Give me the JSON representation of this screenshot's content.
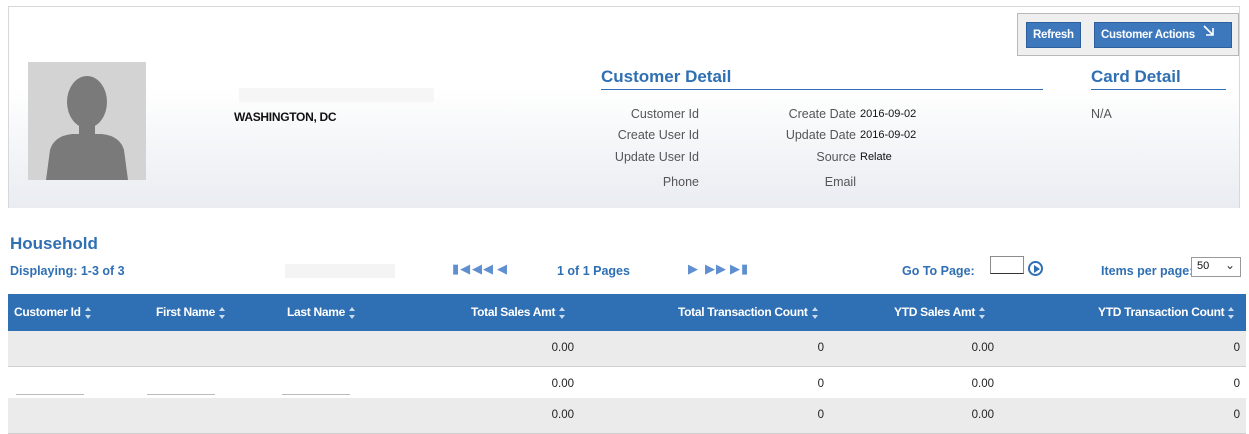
{
  "header": {
    "location": "WASHINGTON, DC",
    "buttons": {
      "refresh": "Refresh",
      "customer_actions": "Customer Actions"
    }
  },
  "customer_detail": {
    "title": "Customer Detail",
    "labels": {
      "customer_id": "Customer Id",
      "create_user_id": "Create User Id",
      "update_user_id": "Update User Id",
      "phone": "Phone",
      "create_date": "Create Date",
      "update_date": "Update Date",
      "source": "Source",
      "email": "Email"
    },
    "values": {
      "create_date": "2016-09-02",
      "update_date": "2016-09-02",
      "source": "Relate"
    }
  },
  "card_detail": {
    "title": "Card Detail",
    "value": "N/A"
  },
  "household": {
    "title": "Household",
    "displaying": "Displaying: 1-3 of 3",
    "page_info": "1 of 1 Pages",
    "goto_label": "Go To Page:",
    "items_per_page_label": "Items per page:",
    "items_per_page_value": "50",
    "columns": [
      "Customer Id",
      "First Name",
      "Last Name",
      "Total Sales Amt",
      "Total Transaction Count",
      "YTD Sales Amt",
      "YTD Transaction Count"
    ],
    "rows": [
      {
        "total_sales": "0.00",
        "total_txn": "0",
        "ytd_sales": "0.00",
        "ytd_txn": "0"
      },
      {
        "total_sales": "0.00",
        "total_txn": "0",
        "ytd_sales": "0.00",
        "ytd_txn": "0"
      },
      {
        "total_sales": "0.00",
        "total_txn": "0",
        "ytd_sales": "0.00",
        "ytd_txn": "0"
      }
    ]
  },
  "icons": {
    "first_page": "first-page-icon",
    "prev_fast": "rewind-icon",
    "prev": "previous-icon",
    "next": "next-icon",
    "next_fast": "fast-forward-icon",
    "last_page": "last-page-icon",
    "go": "go-icon",
    "customer_actions": "arrow-down-right-icon"
  },
  "colors": {
    "accent": "#2f6fb3",
    "button": "#3d78bd",
    "row_alt": "#ebebeb"
  }
}
